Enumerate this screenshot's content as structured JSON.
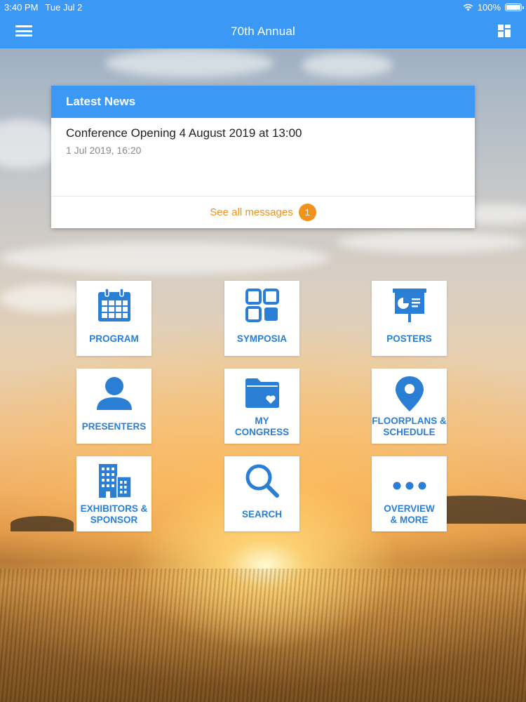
{
  "status_bar": {
    "time": "3:40 PM",
    "date": "Tue Jul 2",
    "battery": "100%",
    "battery_level": 1.0
  },
  "nav_bar": {
    "title": "70th Annual",
    "menu_icon": "hamburger-menu-icon",
    "dashboard_icon": "dashboard-grid-icon"
  },
  "latest_news": {
    "header": "Latest News",
    "items": [
      {
        "title": "Conference Opening 4 August 2019 at 13:00",
        "date": "1 Jul 2019, 16:20"
      }
    ],
    "see_all_label": "See all messages",
    "unread_count": "1"
  },
  "tiles": [
    {
      "label": "PROGRAM",
      "icon": "calendar-icon"
    },
    {
      "label": "SYMPOSIA",
      "icon": "grid-squares-icon"
    },
    {
      "label": "POSTERS",
      "icon": "presentation-board-icon"
    },
    {
      "label": "PRESENTERS",
      "icon": "person-icon"
    },
    {
      "label": "MY\nCONGRESS",
      "icon": "folder-heart-icon"
    },
    {
      "label": "FLOORPLANS &\nSCHEDULE",
      "icon": "map-pin-icon"
    },
    {
      "label": "EXHIBITORS &\nSPONSOR",
      "icon": "buildings-icon"
    },
    {
      "label": "SEARCH",
      "icon": "search-icon"
    },
    {
      "label": "OVERVIEW\n& MORE",
      "icon": "more-dots-icon"
    }
  ],
  "colors": {
    "primary": "#3b98f4",
    "tile_text": "#2a7fd4",
    "accent": "#f0921c"
  }
}
